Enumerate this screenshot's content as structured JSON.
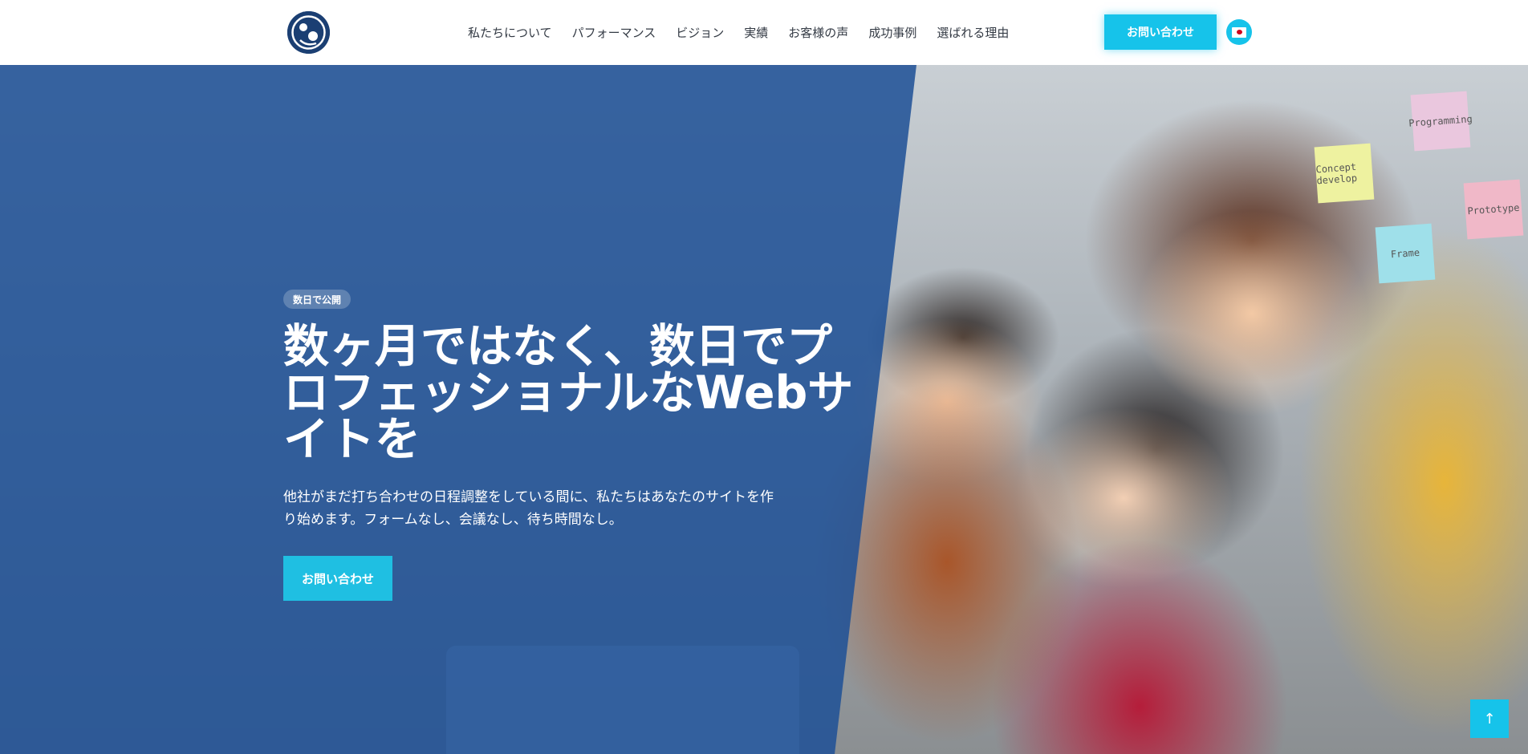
{
  "header": {
    "nav": [
      "私たちについて",
      "パフォーマンス",
      "ビジョン",
      "実績",
      "お客様の声",
      "成功事例",
      "選ばれる理由"
    ],
    "cta_label": "お問い合わせ",
    "language_icon": "japan-flag-icon"
  },
  "hero": {
    "badge": "数日で公開",
    "headline_lines": [
      "数ヶ月ではなく、数日でプ",
      "ロフェッショナルなWebサ",
      "イトを"
    ],
    "subtext_lines": [
      "他社がまだ打ち合わせの日程調整をしている間に、私たちはあなたのサイトを作",
      "り始めます。フォームなし、会議なし、待ち時間なし。"
    ],
    "cta_label": "お問い合わせ",
    "photo_notes": [
      "Programming",
      "Concept develop",
      "Prototype",
      "Frame"
    ]
  },
  "scroll_top_icon": "↑",
  "colors": {
    "accent": "#16c3ea",
    "hero_overlay": "#1e5096",
    "logo": "#1b3f73",
    "nav_text": "#333a44"
  }
}
